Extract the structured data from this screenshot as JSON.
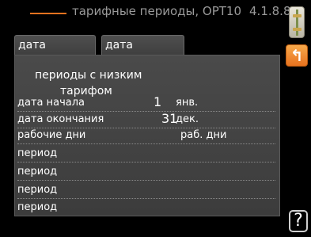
{
  "header": {
    "title": "тарифные периоды, OPT10",
    "menu_number": "4.1.8.8",
    "accent_color": "#e8731f"
  },
  "icons": {
    "device": "heat-pump-device-icon",
    "back": "back-arrow-icon",
    "help": "help-icon",
    "help_glyph": "?"
  },
  "tabs": [
    {
      "label": "дата"
    },
    {
      "label": "дата"
    }
  ],
  "panel": {
    "heading_line1": "периоды с низким",
    "heading_line2": "тарифом",
    "rows": [
      {
        "label": "дата начала",
        "number": "1",
        "value": "янв."
      },
      {
        "label": "дата окончания",
        "number": "31",
        "value": "дек."
      },
      {
        "label": "рабочие дни",
        "value": "раб. дни"
      },
      {
        "label": "период"
      },
      {
        "label": "период"
      },
      {
        "label": "период"
      },
      {
        "label": "период"
      }
    ]
  }
}
